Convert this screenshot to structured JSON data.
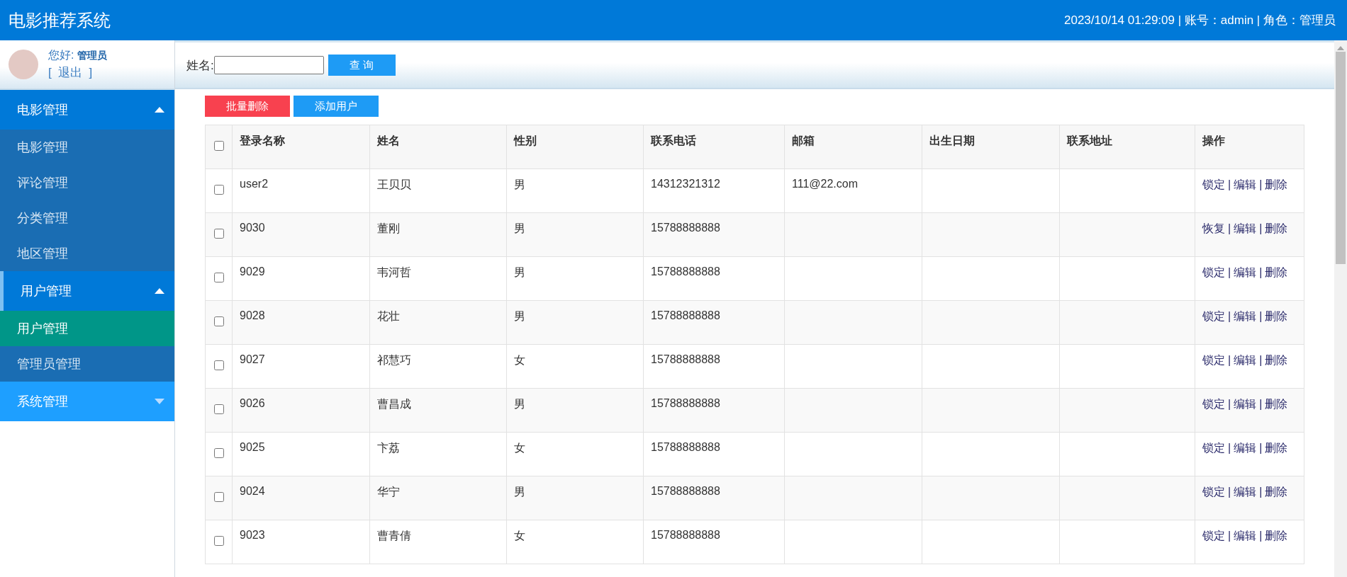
{
  "header": {
    "title": "电影推荐系统",
    "info": "2023/10/14 01:29:09 | 账号：admin | 角色：管理员"
  },
  "user_panel": {
    "greeting": "您好:",
    "role": "管理员",
    "logout": "[  退出  ]"
  },
  "sidebar": {
    "groups": [
      {
        "label": "电影管理",
        "expanded": true,
        "items": [
          {
            "label": "电影管理",
            "selected": false
          },
          {
            "label": "评论管理",
            "selected": false
          },
          {
            "label": "分类管理",
            "selected": false
          },
          {
            "label": "地区管理",
            "selected": false
          }
        ]
      },
      {
        "label": "用户管理",
        "expanded": true,
        "items": [
          {
            "label": "用户管理",
            "selected": true
          },
          {
            "label": "管理员管理",
            "selected": false
          }
        ]
      },
      {
        "label": "系统管理",
        "expanded": false
      }
    ]
  },
  "search": {
    "label": "姓名:",
    "button": "查 询"
  },
  "actions": [
    {
      "kind": "danger",
      "label": "批量删除"
    },
    {
      "kind": "primary",
      "label": "添加用户"
    }
  ],
  "table": {
    "select_all_checked": false,
    "columns": [
      "登录名称",
      "姓名",
      "性别",
      "联系电话",
      "邮箱",
      "出生日期",
      "联系地址",
      "操作"
    ],
    "rows": [
      {
        "checked": false,
        "cells": [
          "user2",
          "王贝贝",
          "男",
          "14312321312",
          "111@22.com",
          "",
          ""
        ],
        "actions": [
          {
            "kind": "link",
            "label": "锁定"
          },
          {
            "kind": "separator",
            "label": "|"
          },
          {
            "kind": "link",
            "label": "编辑"
          },
          {
            "kind": "separator",
            "label": "|"
          },
          {
            "kind": "link",
            "label": "删除"
          }
        ]
      },
      {
        "checked": false,
        "cells": [
          "9030",
          "董刚",
          "男",
          "15788888888",
          "",
          "",
          ""
        ],
        "actions": [
          {
            "kind": "link",
            "label": "恢复"
          },
          {
            "kind": "separator",
            "label": "|"
          },
          {
            "kind": "link",
            "label": "编辑"
          },
          {
            "kind": "separator",
            "label": "|"
          },
          {
            "kind": "link",
            "label": "删除"
          }
        ]
      },
      {
        "checked": false,
        "cells": [
          "9029",
          "韦河哲",
          "男",
          "15788888888",
          "",
          "",
          ""
        ],
        "actions": [
          {
            "kind": "link",
            "label": "锁定"
          },
          {
            "kind": "separator",
            "label": "|"
          },
          {
            "kind": "link",
            "label": "编辑"
          },
          {
            "kind": "separator",
            "label": "|"
          },
          {
            "kind": "link",
            "label": "删除"
          }
        ]
      },
      {
        "checked": false,
        "cells": [
          "9028",
          "花壮",
          "男",
          "15788888888",
          "",
          "",
          ""
        ],
        "actions": [
          {
            "kind": "link",
            "label": "锁定"
          },
          {
            "kind": "separator",
            "label": "|"
          },
          {
            "kind": "link",
            "label": "编辑"
          },
          {
            "kind": "separator",
            "label": "|"
          },
          {
            "kind": "link",
            "label": "删除"
          }
        ]
      },
      {
        "checked": false,
        "cells": [
          "9027",
          "祁慧巧",
          "女",
          "15788888888",
          "",
          "",
          ""
        ],
        "actions": [
          {
            "kind": "link",
            "label": "锁定"
          },
          {
            "kind": "separator",
            "label": "|"
          },
          {
            "kind": "link",
            "label": "编辑"
          },
          {
            "kind": "separator",
            "label": "|"
          },
          {
            "kind": "link",
            "label": "删除"
          }
        ]
      },
      {
        "checked": false,
        "cells": [
          "9026",
          "曹昌成",
          "男",
          "15788888888",
          "",
          "",
          ""
        ],
        "actions": [
          {
            "kind": "link",
            "label": "锁定"
          },
          {
            "kind": "separator",
            "label": "|"
          },
          {
            "kind": "link",
            "label": "编辑"
          },
          {
            "kind": "separator",
            "label": "|"
          },
          {
            "kind": "link",
            "label": "删除"
          }
        ]
      },
      {
        "checked": false,
        "cells": [
          "9025",
          "卞荔",
          "女",
          "15788888888",
          "",
          "",
          ""
        ],
        "actions": [
          {
            "kind": "link",
            "label": "锁定"
          },
          {
            "kind": "separator",
            "label": "|"
          },
          {
            "kind": "link",
            "label": "编辑"
          },
          {
            "kind": "separator",
            "label": "|"
          },
          {
            "kind": "link",
            "label": "删除"
          }
        ]
      },
      {
        "checked": false,
        "cells": [
          "9024",
          "华宁",
          "男",
          "15788888888",
          "",
          "",
          ""
        ],
        "actions": [
          {
            "kind": "link",
            "label": "锁定"
          },
          {
            "kind": "separator",
            "label": "|"
          },
          {
            "kind": "link",
            "label": "编辑"
          },
          {
            "kind": "separator",
            "label": "|"
          },
          {
            "kind": "link",
            "label": "删除"
          }
        ]
      },
      {
        "checked": false,
        "cells": [
          "9023",
          "曹青倩",
          "女",
          "15788888888",
          "",
          "",
          ""
        ],
        "actions": [
          {
            "kind": "link",
            "label": "锁定"
          },
          {
            "kind": "separator",
            "label": "|"
          },
          {
            "kind": "link",
            "label": "编辑"
          },
          {
            "kind": "separator",
            "label": "|"
          },
          {
            "kind": "link",
            "label": "删除"
          }
        ]
      }
    ]
  }
}
